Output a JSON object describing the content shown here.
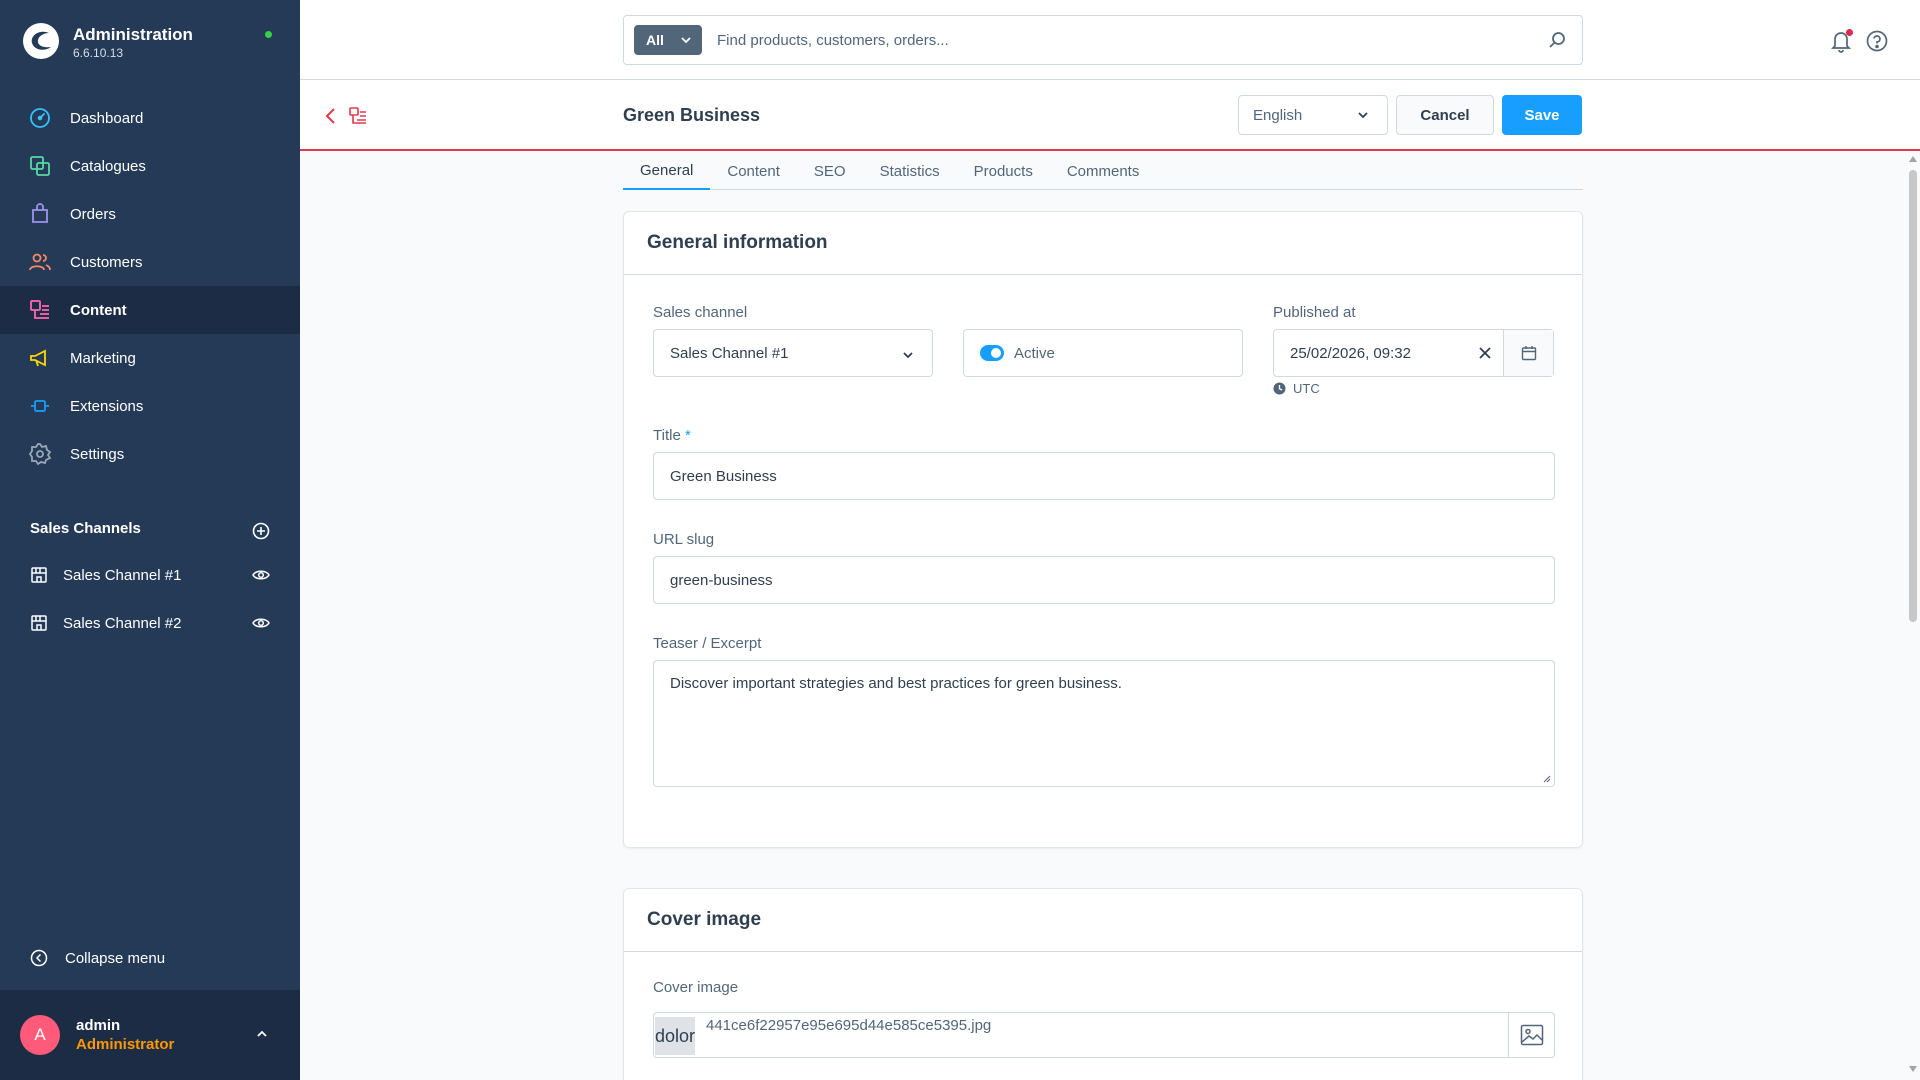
{
  "brand": {
    "title": "Administration",
    "version": "6.6.10.13",
    "status_color": "#37d046"
  },
  "nav": [
    {
      "label": "Dashboard",
      "icon": "dashboard-icon",
      "color": "#34c3ff"
    },
    {
      "label": "Catalogues",
      "icon": "catalogues-icon",
      "color": "#57d9a3"
    },
    {
      "label": "Orders",
      "icon": "orders-icon",
      "color": "#a092f0"
    },
    {
      "label": "Customers",
      "icon": "customers-icon",
      "color": "#f88962"
    },
    {
      "label": "Content",
      "icon": "content-icon",
      "color": "#ff68b4",
      "active": true
    },
    {
      "label": "Marketing",
      "icon": "marketing-icon",
      "color": "#ffd700"
    },
    {
      "label": "Extensions",
      "icon": "extensions-icon",
      "color": "#189eff"
    },
    {
      "label": "Settings",
      "icon": "settings-icon",
      "color": "#9aa8b5"
    }
  ],
  "sales_channels": {
    "title": "Sales Channels",
    "items": [
      {
        "label": "Sales Channel #1",
        "icon": "storefront-icon"
      },
      {
        "label": "Sales Channel #2",
        "icon": "storefront-icon"
      }
    ]
  },
  "collapse_menu": "Collapse menu",
  "user": {
    "initial": "A",
    "name": "admin",
    "role": "Administrator"
  },
  "search": {
    "type": "All",
    "placeholder": "Find products, customers, orders..."
  },
  "smartbar": {
    "title": "Green Business",
    "language": "English",
    "cancel": "Cancel",
    "save": "Save"
  },
  "tabs": [
    "General",
    "Content",
    "SEO",
    "Statistics",
    "Products",
    "Comments"
  ],
  "general_info": {
    "title": "General information",
    "sales_channel_label": "Sales channel",
    "sales_channel_value": "Sales Channel #1",
    "active_label": "Active",
    "published_label": "Published at",
    "published_value": "25/02/2026, 09:32",
    "timezone": "UTC",
    "title_label": "Title",
    "title_required": "*",
    "title_value": "Green Business",
    "slug_label": "URL slug",
    "slug_value": "green-business",
    "teaser_label": "Teaser / Excerpt",
    "teaser_value": "Discover important strategies and best practices for green business."
  },
  "cover": {
    "title": "Cover image",
    "field_label": "Cover image",
    "thumb_text": "dolor",
    "file_name": "441ce6f22957e95e695d44e585ce5395.jpg"
  },
  "colors": {
    "sidebar": "#243a56",
    "primary": "#189eff",
    "accent_red": "#e3394d"
  }
}
